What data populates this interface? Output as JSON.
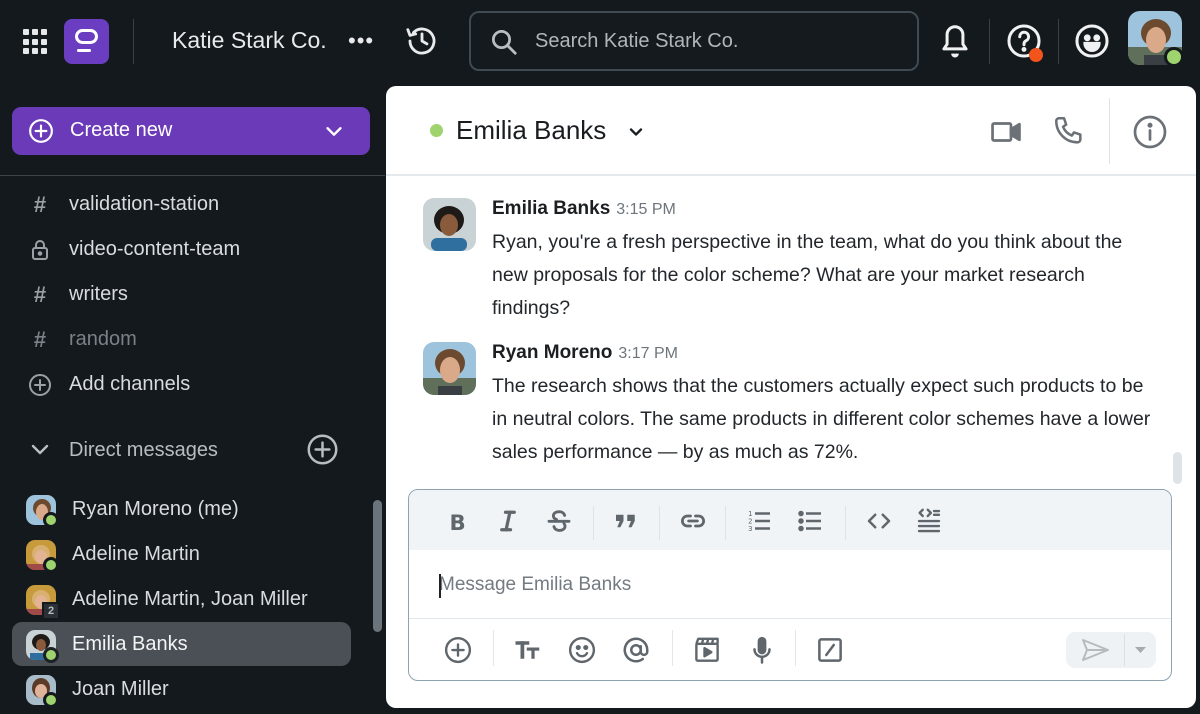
{
  "topbar": {
    "workspace_name": "Katie Stark Co.",
    "more_label": "•••",
    "search_placeholder": "Search Katie Stark Co.",
    "help_badge_color": "#f2541b",
    "user_status_color": "#9ed36e",
    "brand_color": "#6b3ec1"
  },
  "sidebar": {
    "create_new_label": "Create new",
    "channels": [
      {
        "label": "validation-station",
        "icon": "hash-icon",
        "muted": false
      },
      {
        "label": "video-content-team",
        "icon": "lock-icon",
        "muted": false
      },
      {
        "label": "writers",
        "icon": "hash-icon",
        "muted": false
      },
      {
        "label": "random",
        "icon": "hash-icon",
        "muted": true
      }
    ],
    "add_channels_label": "Add channels",
    "direct_messages_label": "Direct messages",
    "direct_messages": [
      {
        "label": "Ryan Moreno (me)",
        "status": "online",
        "active": false
      },
      {
        "label": "Adeline Martin",
        "status": "online",
        "active": false
      },
      {
        "label": "Adeline Martin, Joan Miller",
        "group_count": "2",
        "active": false
      },
      {
        "label": "Emilia Banks",
        "status": "online",
        "active": true
      },
      {
        "label": "Joan Miller",
        "status": "online",
        "active": false
      }
    ]
  },
  "channel": {
    "name": "Emilia Banks",
    "status": "online"
  },
  "messages": [
    {
      "author": "Emilia Banks",
      "time": "3:15 PM",
      "text": "Ryan, you're a fresh perspective in the team, what do you think about the new proposals for the color scheme? What are your market research findings?"
    },
    {
      "author": "Ryan Moreno",
      "time": "3:17 PM",
      "text": "The research shows that the customers actually expect such products to be in neutral colors. The same products in different color schemes have a lower sales performance — by as much as 72%."
    }
  ],
  "composer": {
    "placeholder": "Message Emilia Banks",
    "value": "",
    "format_tools": [
      "bold",
      "italic",
      "strikethrough",
      "quote",
      "link",
      "numbered-list",
      "bulleted-list",
      "code",
      "code-block"
    ],
    "action_tools": [
      "add-attachment",
      "text-format",
      "emoji",
      "mention",
      "video-clip",
      "voice-message",
      "shortcuts"
    ]
  }
}
